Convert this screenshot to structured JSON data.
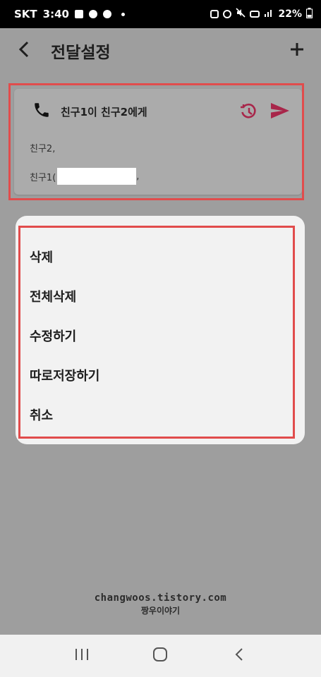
{
  "status_bar": {
    "carrier": "SKT",
    "time": "3:40",
    "battery": "22%",
    "icons": [
      "gallery-icon",
      "chat-icon",
      "alert-icon",
      "dot-icon",
      "alarm-icon",
      "mute-icon",
      "volte-icon",
      "signal-icon",
      "battery-icon"
    ]
  },
  "app_bar": {
    "title": "전달설정",
    "back_icon": "chevron-left-icon",
    "add_icon": "plus-icon"
  },
  "message_card": {
    "icon": "phone-icon",
    "title": "친구1이 친구2에게",
    "history_icon": "history-icon",
    "send_icon": "send-icon",
    "recipient_1": "친구2,",
    "recipient_2_prefix": "친구1(",
    "recipient_2_suffix": ",",
    "accent_color": "#a8264a"
  },
  "menu": {
    "items": [
      {
        "label": "삭제"
      },
      {
        "label": "전체삭제"
      },
      {
        "label": "수정하기"
      },
      {
        "label": "따로저장하기"
      },
      {
        "label": "취소"
      }
    ]
  },
  "watermark": {
    "line1": "changwoos.tistory.com",
    "line2": "짱우이야기"
  },
  "nav_bar": {
    "recents_icon": "recents-icon",
    "home_icon": "home-icon",
    "back_icon": "back-icon"
  },
  "colors": {
    "highlight_outline": "#e14c4c",
    "dim_background": "#9e9e9e"
  }
}
